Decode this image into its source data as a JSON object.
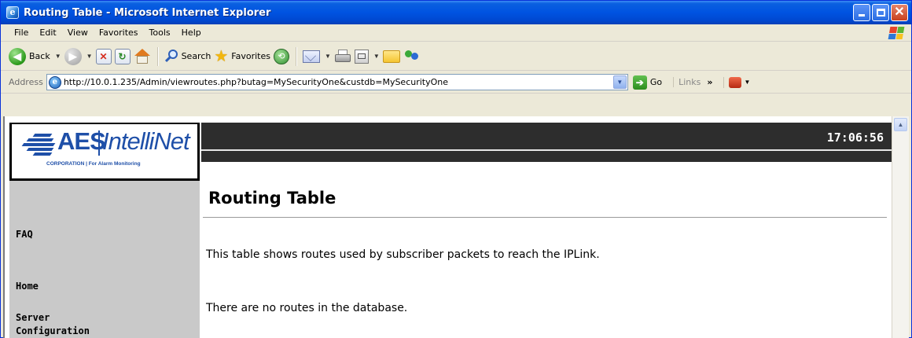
{
  "window": {
    "title": "Routing Table - Microsoft Internet Explorer",
    "icon": "ie-icon"
  },
  "menubar": {
    "items": [
      "File",
      "Edit",
      "View",
      "Favorites",
      "Tools",
      "Help"
    ]
  },
  "toolbar": {
    "back_label": "Back",
    "search_label": "Search",
    "favorites_label": "Favorites"
  },
  "addressbar": {
    "label": "Address",
    "url": "http://10.0.1.235/Admin/viewroutes.php?butag=MySecurityOne&custdb=MySecurityOne",
    "go_label": "Go",
    "links_label": "Links"
  },
  "logo": {
    "brand": "AES",
    "product": "IntelliNet",
    "tagline": "CORPORATION | For Alarm Monitoring"
  },
  "sidebar": {
    "items": [
      {
        "label": "FAQ"
      },
      {
        "label": "Home"
      },
      {
        "label": "Server"
      },
      {
        "label": "Configuration"
      }
    ]
  },
  "header": {
    "clock": "17:06:56"
  },
  "content": {
    "title": "Routing Table",
    "description": "This table shows routes used by subscriber packets to reach the IPLink.",
    "empty_message": "There are no routes in the database."
  }
}
